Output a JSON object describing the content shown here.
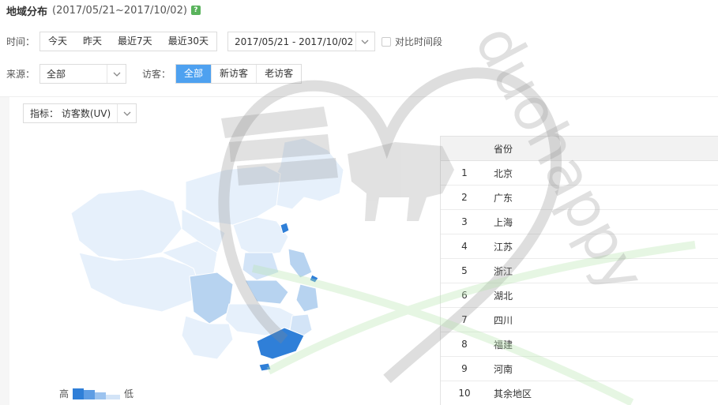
{
  "header": {
    "title": "地域分布",
    "date_range": "(2017/05/21~2017/10/02)",
    "help_icon": "?"
  },
  "time_filter": {
    "label": "时间：",
    "options": [
      "今天",
      "昨天",
      "最近7天",
      "最近30天"
    ],
    "date_value": "2017/05/21 - 2017/10/02",
    "compare_label": "对比时间段"
  },
  "source_filter": {
    "label": "来源：",
    "value": "全部"
  },
  "visitor_filter": {
    "label": "访客：",
    "options": [
      "全部",
      "新访客",
      "老访客"
    ],
    "active_index": 0
  },
  "metric_select": {
    "label": "指标：",
    "value": "访客数(UV)"
  },
  "legend": {
    "high": "高",
    "low": "低"
  },
  "table": {
    "header_province": "省份",
    "rows": [
      {
        "rank": "1",
        "province": "北京"
      },
      {
        "rank": "2",
        "province": "广东"
      },
      {
        "rank": "3",
        "province": "上海"
      },
      {
        "rank": "4",
        "province": "江苏"
      },
      {
        "rank": "5",
        "province": "浙江"
      },
      {
        "rank": "6",
        "province": "湖北"
      },
      {
        "rank": "7",
        "province": "四川"
      },
      {
        "rank": "8",
        "province": "福建"
      },
      {
        "rank": "9",
        "province": "河南"
      },
      {
        "rank": "10",
        "province": "其余地区"
      }
    ]
  },
  "watermark_text": "duohappy",
  "colors": {
    "accent": "#4ea1f0",
    "map_high": "#2f7fd8",
    "map_mid": "#b7d3f0",
    "map_low": "#e6f0fb",
    "help_green": "#59b35c"
  }
}
